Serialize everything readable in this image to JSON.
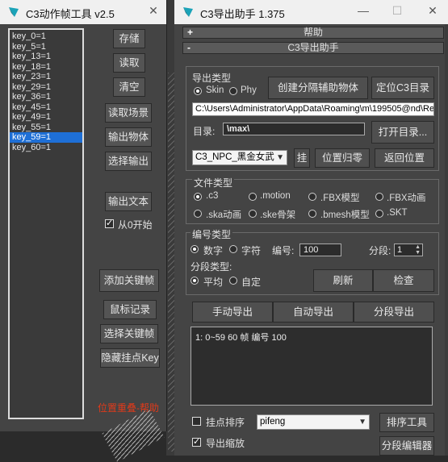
{
  "left_window": {
    "title": "C3动作帧工具 v2.5",
    "close": "✕",
    "keys": [
      "key_0=1",
      "key_5=1",
      "key_13=1",
      "key_18=1",
      "key_23=1",
      "key_29=1",
      "key_36=1",
      "key_45=1",
      "key_49=1",
      "key_55=1",
      "key_59=1",
      "key_60=1"
    ],
    "selected_key_index": 10,
    "buttons": {
      "save": "存储",
      "read": "读取",
      "clear": "清空",
      "read_scene": "读取场景",
      "export_object": "输出物体",
      "select_export": "选择输出",
      "export_text": "输出文本",
      "add_keyframe": "添加关键帧",
      "mouse_record": "鼠标记录",
      "select_keyframe": "选择关键帧",
      "hide_hook_key": "隐藏挂点Key"
    },
    "from_zero_label": "从0开始",
    "from_zero_checked": true,
    "red_text": "位置重叠-帮助"
  },
  "right_window": {
    "title": "C3导出助手 1.375",
    "controls": {
      "minimize": "—",
      "maximize": "☐",
      "close": "✕"
    },
    "help_rollout": {
      "sign": "+",
      "label": "帮助"
    },
    "main_rollout": {
      "sign": "-",
      "label": "C3导出助手"
    },
    "export_type": {
      "label": "导出类型",
      "skin_label": "Skin",
      "phy_label": "Phy",
      "selected": "Skin",
      "create_helper_button": "创建分隔辅助物体",
      "locate_dir_button": "定位C3目录",
      "path_value": "C:\\Users\\Administrator\\AppData\\Roaming\\m\\199505@nd\\Re",
      "dir_label": "目录:",
      "dir_value": "\\max\\",
      "open_dir_button": "打开目录...",
      "npc_select": "C3_NPC_黑金女武",
      "hang_button": "挂",
      "reset_pos_button": "位置归零",
      "return_pos_button": "返回位置"
    },
    "file_type": {
      "label": "文件类型",
      "options": [
        ".c3",
        ".motion",
        ".FBX模型",
        ".FBX动画",
        ".ska动画",
        ".ske骨架",
        ".bmesh模型",
        ".SKT"
      ],
      "selected": ".c3"
    },
    "number_type": {
      "label": "编号类型",
      "digit_label": "数字",
      "char_label": "字符",
      "selected": "数字",
      "number_label": "编号:",
      "number_value": "100",
      "segment_label": "分段:",
      "segment_value": "1",
      "segment_type_label": "分段类型:",
      "avg_label": "平均",
      "custom_label": "自定",
      "segment_selected": "平均",
      "refresh_button": "刷新",
      "check_button": "检查"
    },
    "export_buttons": {
      "manual": "手动导出",
      "auto": "自动导出",
      "segment": "分段导出"
    },
    "output_text": "1: 0~59 60 帧 编号 100",
    "hook_sort_label": "挂点排序",
    "hook_sort_checked": false,
    "sort_select": "pifeng",
    "sort_tool_button": "排序工具",
    "export_scale_label": "导出缩放",
    "export_scale_checked": true,
    "segment_editor_button": "分段编辑器"
  }
}
